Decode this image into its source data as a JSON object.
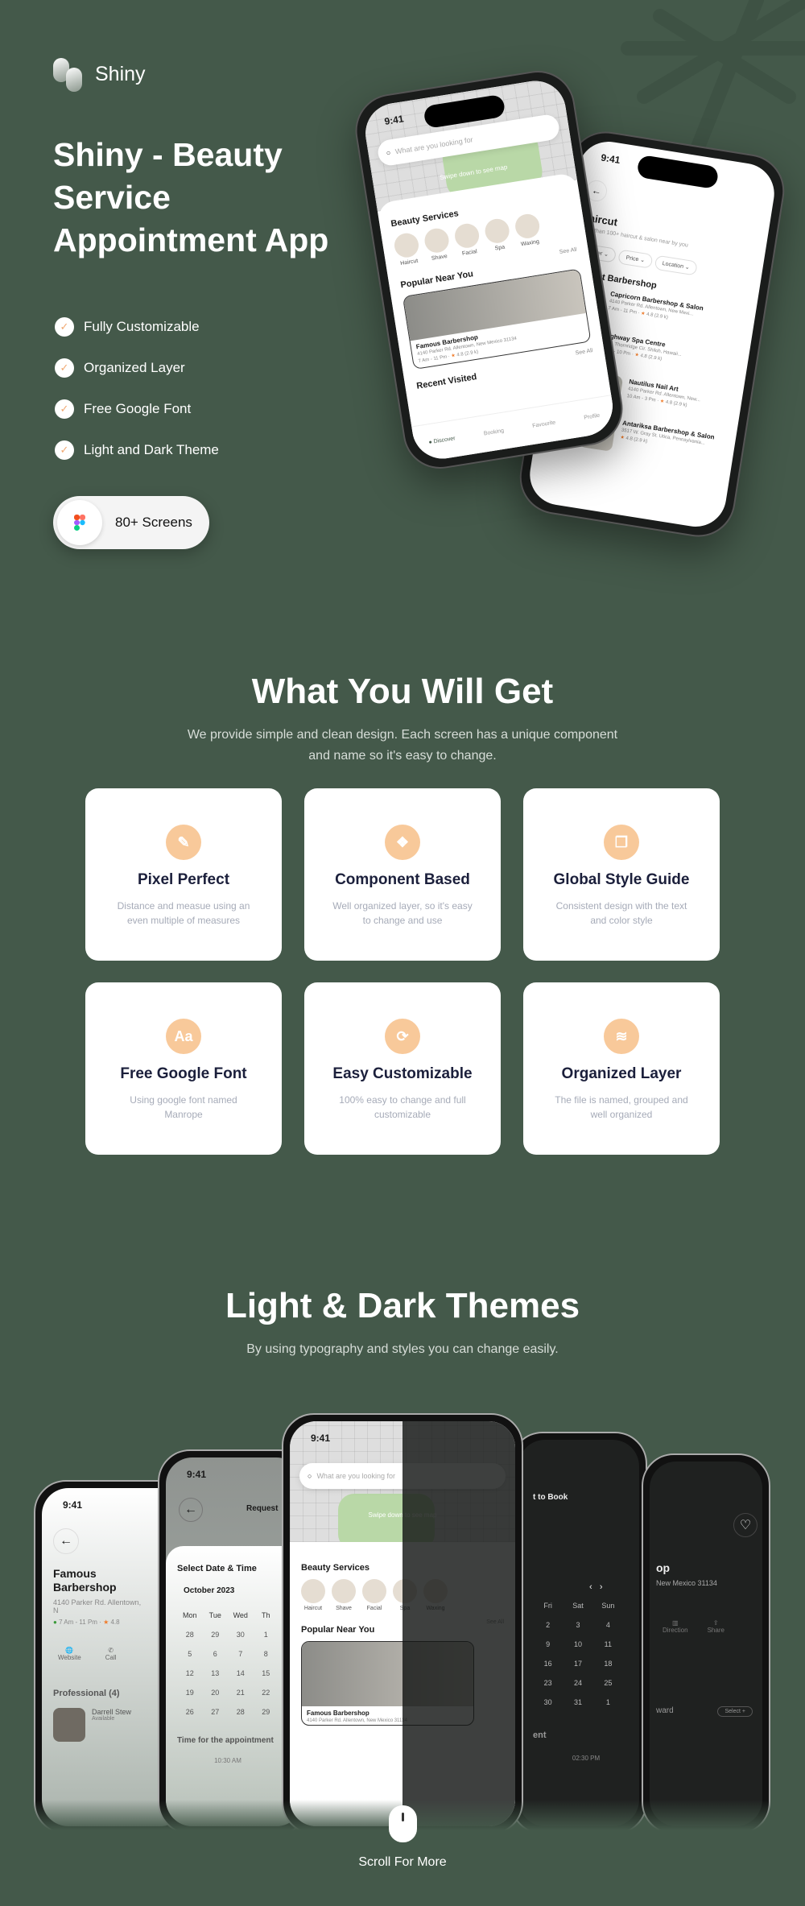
{
  "brand": {
    "name": "Shiny"
  },
  "hero": {
    "title_lines": [
      "Shiny - Beauty",
      "Service",
      "Appointment App"
    ],
    "features": [
      "Fully Customizable",
      "Organized Layer",
      "Free Google Font",
      "Light and Dark Theme"
    ],
    "badge": "80+ Screens"
  },
  "phone_discover": {
    "time": "9:41",
    "search_placeholder": "What are you looking for",
    "swipe_hint": "Swipe down to see map",
    "services_title": "Beauty Services",
    "services": [
      "Haircut",
      "Shave",
      "Facial",
      "Spa",
      "Waxing"
    ],
    "see_all": "See All",
    "popular_title": "Popular Near You",
    "popular": {
      "name": "Famous Barbershop",
      "address": "4140 Parker Rd. Allentown, New Mexico 31134",
      "hours": "7 Am - 11 Pm",
      "rating": "4.8",
      "reviews": "(2.9 k)"
    },
    "recent_title": "Recent Visited",
    "nav": [
      "Discover",
      "Booking",
      "Favourite",
      "Profile"
    ]
  },
  "phone_haircut": {
    "time": "9:41",
    "title": "Haircut",
    "subtitle": "More than 100+ haircut & salon near by you",
    "filters": [
      "Gender",
      "Price",
      "Location"
    ],
    "section": "Nearest Barbershop",
    "items": [
      {
        "name": "Capricorn Barbershop & Salon",
        "address": "4140 Parker Rd. Allentown, New Mexi...",
        "hours": "7 Am - 11 Pm",
        "rating": "4.8 (2.9 k)"
      },
      {
        "name": "Highway Spa Centre",
        "address": "1901 Thornridge Cir. Shiloh, Hawaii...",
        "hours": "9 Am - 10 Pm",
        "rating": "4.8 (2.9 k)"
      },
      {
        "name": "Nautilus Nail Art",
        "address": "4140 Parker Rd. Allentown, New...",
        "hours": "10 Am - 3 Pm",
        "rating": "4.8 (2.9 k)"
      },
      {
        "name": "Antariksa Barbershop & Salon",
        "address": "3517 W. Gray St. Utica, Pennsylvania...",
        "hours": "",
        "rating": "4.8 (2.9 k)"
      }
    ]
  },
  "get": {
    "title": "What You Will Get",
    "subtitle_lines": [
      "We provide simple and clean design. Each screen has a unique component",
      "and name so it's easy to change."
    ],
    "cards": [
      {
        "title": "Pixel Perfect",
        "desc": "Distance and measue using an even multiple of measures",
        "icon": "pen-tool-icon"
      },
      {
        "title": "Component Based",
        "desc": "Well organized layer, so it's easy to change and use",
        "icon": "component-icon"
      },
      {
        "title": "Global Style Guide",
        "desc": "Consistent design with the text and color style",
        "icon": "copy-icon"
      },
      {
        "title": "Free Google Font",
        "desc": "Using google font named Manrope",
        "icon": "font-icon"
      },
      {
        "title": "Easy Customizable",
        "desc": "100% easy to change and full customizable",
        "icon": "refresh-icon"
      },
      {
        "title": "Organized Layer",
        "desc": "The file is named, grouped and well organized",
        "icon": "layers-icon"
      }
    ]
  },
  "themes": {
    "title": "Light & Dark Themes",
    "subtitle": "By using typography and styles you can change easily.",
    "detail": {
      "time": "9:41",
      "name": "Famous Barbershop",
      "address": "4140 Parker Rd. Allentown, N",
      "hours": "7 Am - 11 Pm",
      "rating": "4.8",
      "website": "Website",
      "call": "Call",
      "professional": "Professional (4)",
      "pro_name": "Darrell Stew",
      "pro_status": "Available"
    },
    "booking": {
      "time": "9:41",
      "header": "Request",
      "section": "Select Date & Time",
      "month": "October 2023",
      "days": [
        "Mon",
        "Tue",
        "Wed",
        "Th"
      ],
      "dates": [
        "28",
        "29",
        "30",
        "1",
        "5",
        "6",
        "7",
        "8",
        "12",
        "13",
        "14",
        "15",
        "19",
        "20",
        "21",
        "22",
        "26",
        "27",
        "28",
        "29"
      ],
      "time_title": "Time for the appointment",
      "slot": "10:30 AM"
    },
    "dark_booking": {
      "header": "t to Book",
      "days": [
        "Fri",
        "Sat",
        "Sun"
      ],
      "dates": [
        "2",
        "3",
        "4",
        "9",
        "10",
        "11",
        "16",
        "17",
        "18",
        "23",
        "24",
        "25",
        "30",
        "31",
        "1"
      ],
      "section": "ent",
      "slot": "02:30 PM"
    },
    "dark_detail": {
      "name": "op",
      "address": "New Mexico 31134",
      "direction": "Direction",
      "share": "Share",
      "row1": "ward",
      "select": "Select"
    },
    "scroll": "Scroll For More"
  },
  "colors": {
    "background": "#44594a",
    "accent": "#f8c99a",
    "card_title": "#1b1f3b",
    "star": "#f07c2a"
  }
}
